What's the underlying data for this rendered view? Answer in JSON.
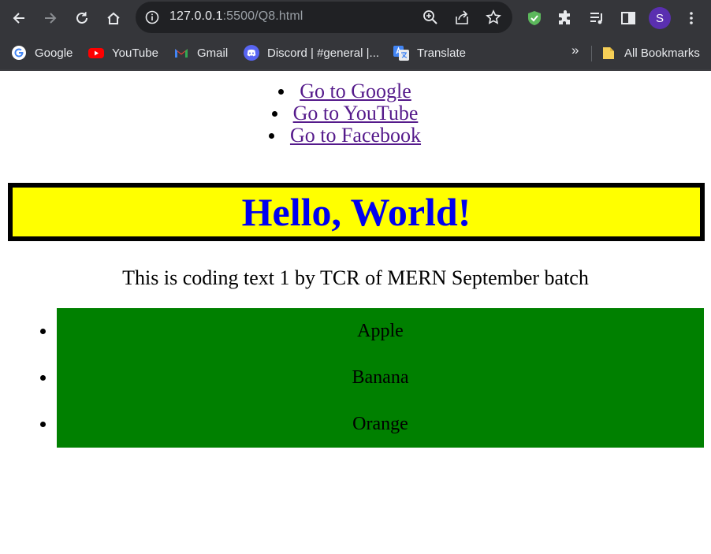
{
  "browser": {
    "url_host": "127.0.0.1",
    "url_rest": ":5500/Q8.html",
    "avatar_letter": "S",
    "bookmarks": [
      {
        "label": "Google",
        "icon": "google-icon"
      },
      {
        "label": "YouTube",
        "icon": "youtube-icon"
      },
      {
        "label": "Gmail",
        "icon": "gmail-icon"
      },
      {
        "label": "Discord | #general |...",
        "icon": "discord-icon"
      },
      {
        "label": "Translate",
        "icon": "translate-icon"
      }
    ],
    "more_label": "»",
    "all_bookmarks_label": "All Bookmarks"
  },
  "page": {
    "links": [
      {
        "label": "Go to Google"
      },
      {
        "label": "Go to YouTube"
      },
      {
        "label": "Go to Facebook"
      }
    ],
    "heading": "Hello, World!",
    "paragraph": "This is coding text 1 by TCR of MERN September batch",
    "fruits": [
      "Apple",
      "Banana",
      "Orange"
    ],
    "colors": {
      "heading_bg": "#ffff00",
      "heading_text": "#0000ee",
      "heading_border": "#000000",
      "list_bg": "#008000",
      "link": "#551a8b"
    }
  }
}
